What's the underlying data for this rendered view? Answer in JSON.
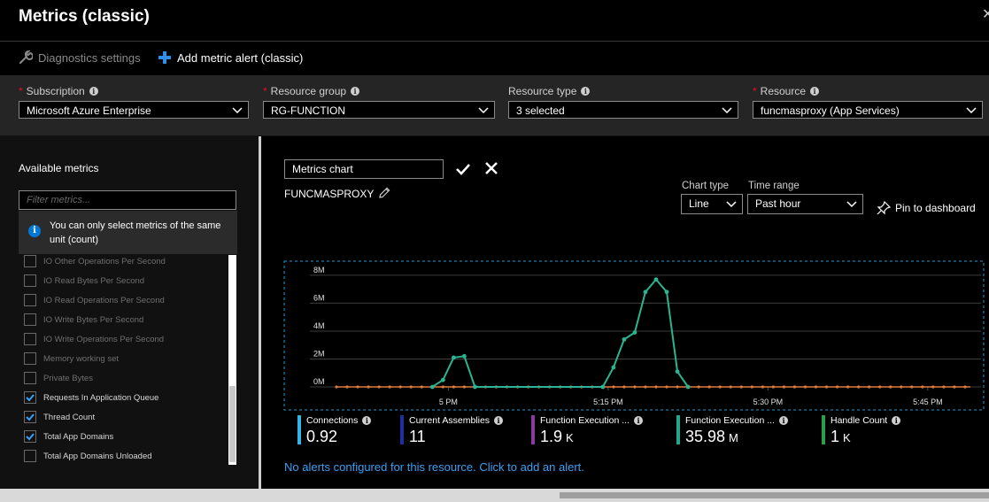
{
  "window": {
    "title": "Metrics (classic)"
  },
  "toolbar": {
    "diagnostics_label": "Diagnostics settings",
    "add_alert_label": "Add metric alert (classic)"
  },
  "filters": {
    "subscription": {
      "label": "Subscription",
      "value": "Microsoft Azure Enterprise"
    },
    "resource_group": {
      "label": "Resource group",
      "value": "RG-FUNCTION"
    },
    "resource_type": {
      "label": "Resource type",
      "value": "3 selected"
    },
    "resource": {
      "label": "Resource",
      "value": "funcmasproxy (App Services)"
    }
  },
  "metrics_panel": {
    "title": "Available metrics",
    "filter_placeholder": "Filter metrics...",
    "tooltip": "You can only select metrics of the same unit (count)",
    "items": [
      {
        "label": "IO Other Operations Per Second",
        "checked": false,
        "enabled": false
      },
      {
        "label": "IO Read Bytes Per Second",
        "checked": false,
        "enabled": false
      },
      {
        "label": "IO Read Operations Per Second",
        "checked": false,
        "enabled": false
      },
      {
        "label": "IO Write Bytes Per Second",
        "checked": false,
        "enabled": false
      },
      {
        "label": "IO Write Operations Per Second",
        "checked": false,
        "enabled": false
      },
      {
        "label": "Memory working set",
        "checked": false,
        "enabled": false
      },
      {
        "label": "Private Bytes",
        "checked": false,
        "enabled": false
      },
      {
        "label": "Requests In Application Queue",
        "checked": true,
        "enabled": true
      },
      {
        "label": "Thread Count",
        "checked": true,
        "enabled": true
      },
      {
        "label": "Total App Domains",
        "checked": true,
        "enabled": true
      },
      {
        "label": "Total App Domains Unloaded",
        "checked": false,
        "enabled": true
      }
    ]
  },
  "chart_panel": {
    "chart_name": "Metrics chart",
    "resource_name": "FUNCMASPROXY",
    "chart_type_label": "Chart type",
    "chart_type_value": "Line",
    "time_range_label": "Time range",
    "time_range_value": "Past hour",
    "pin_label": "Pin to dashboard",
    "alerts_text": "No alerts configured for this resource. Click to add an alert."
  },
  "chart_data": {
    "type": "line",
    "x_ticks": [
      "5 PM",
      "5:15 PM",
      "5:30 PM",
      "5:45 PM"
    ],
    "y_ticks": [
      "0M",
      "2M",
      "4M",
      "6M",
      "8M"
    ],
    "ylim": [
      0,
      8.5
    ],
    "x_range_minutes": [
      -10.5,
      50
    ],
    "series": [
      {
        "name": "Function Execution ...",
        "color": "#2bb491",
        "points": [
          [
            -1.5,
            0
          ],
          [
            -0.5,
            0.5
          ],
          [
            0.5,
            2.1
          ],
          [
            1.5,
            2.2
          ],
          [
            2.5,
            0
          ],
          [
            14.5,
            0
          ],
          [
            15.5,
            1.4
          ],
          [
            16.5,
            3.4
          ],
          [
            17.5,
            3.9
          ],
          [
            18.5,
            6.8
          ],
          [
            19.5,
            7.7
          ],
          [
            20.5,
            6.8
          ],
          [
            21.5,
            1.1
          ],
          [
            22.5,
            0
          ]
        ]
      },
      {
        "name": "Function Execution ...",
        "color": "#e07b3a",
        "points": [
          [
            -10.5,
            0
          ],
          [
            49,
            0
          ]
        ]
      }
    ],
    "dot_spacing_minutes": 1
  },
  "legend": [
    {
      "name": "Connections",
      "value": "0.92",
      "unit": "",
      "color": "#32b5e5"
    },
    {
      "name": "Current Assemblies",
      "value": "11",
      "unit": "",
      "color": "#1e2f9e"
    },
    {
      "name": "Function Execution ...",
      "value": "1.9",
      "unit": "K",
      "color": "#8b3a9f"
    },
    {
      "name": "Function Execution ...",
      "value": "35.98",
      "unit": "M",
      "color": "#1fa88a"
    },
    {
      "name": "Handle Count",
      "value": "1",
      "unit": "K",
      "color": "#2aa04a"
    }
  ],
  "colors": {
    "accent": "#0078d4",
    "link": "#3aa0f3",
    "required": "#e81123"
  }
}
